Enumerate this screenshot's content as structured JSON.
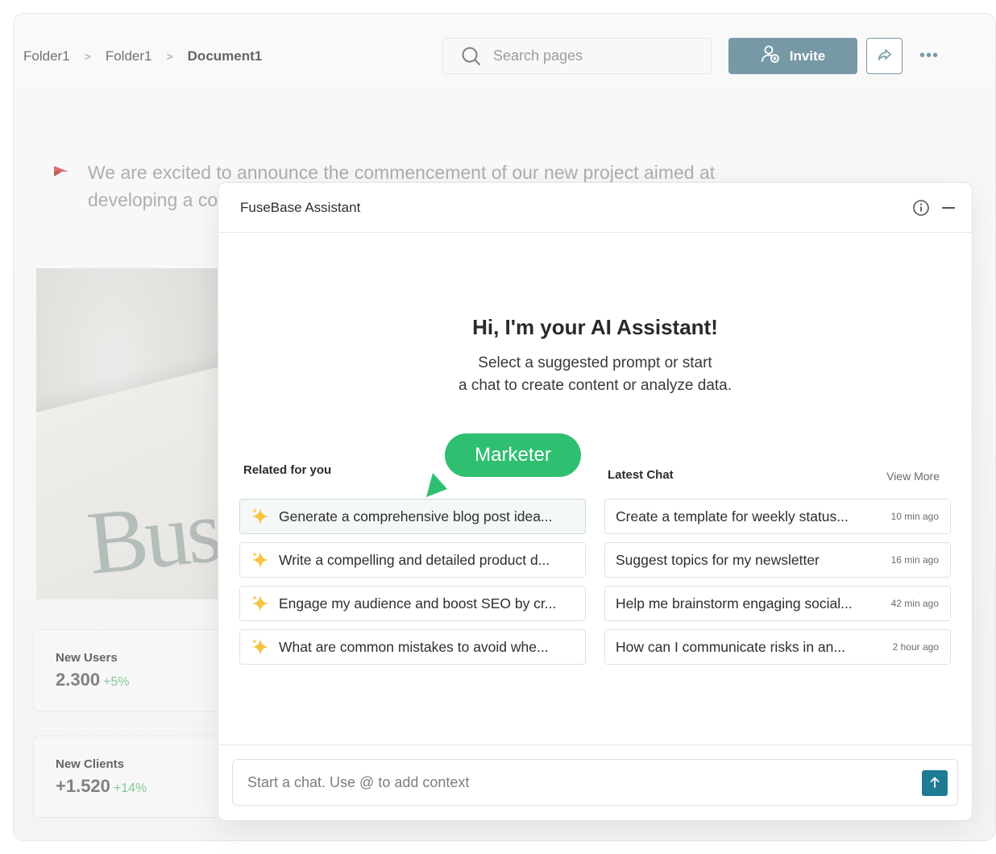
{
  "breadcrumb": {
    "items": [
      "Folder1",
      "Folder1"
    ],
    "current": "Document1"
  },
  "search": {
    "placeholder": "Search pages"
  },
  "toolbar": {
    "invite_label": "Invite",
    "accent_color": "#5f8896"
  },
  "document": {
    "announcement": "We are excited to announce the commencement of our new project aimed at developing a co",
    "stats": [
      {
        "label": "New Users",
        "value": "2.300",
        "delta": "+5%"
      },
      {
        "label": "New Clients",
        "value": "+1.520",
        "delta": "+14%"
      }
    ]
  },
  "assistant": {
    "title": "FuseBase Assistant",
    "greeting": "Hi, I'm your AI Assistant!",
    "subtitle_line1": "Select a suggested prompt or start",
    "subtitle_line2": "a chat to create content or analyze data.",
    "related_title": "Related for you",
    "latest_title": "Latest Chat",
    "view_more": "View More",
    "marketer_label": "Marketer",
    "prompts": [
      "Generate a comprehensive blog post idea...",
      "Write a compelling and detailed product d...",
      "Engage my audience and boost SEO by cr...",
      " What are common mistakes to avoid whe..."
    ],
    "chats": [
      {
        "title": "Create a template for weekly status...",
        "time": "10 min ago"
      },
      {
        "title": "Suggest topics for my newsletter",
        "time": "16 min ago"
      },
      {
        "title": "Help me brainstorm engaging social...",
        "time": "42 min ago"
      },
      {
        "title": "How can I  communicate risks in an...",
        "time": "2 hour ago"
      }
    ],
    "composer_placeholder": "Start a chat. Use @ to add context",
    "send_color": "#1f7a94",
    "marketer_color": "#2fbf71"
  }
}
